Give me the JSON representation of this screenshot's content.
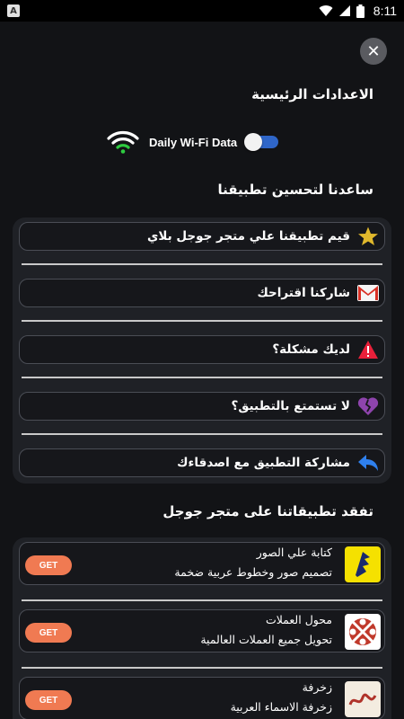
{
  "status_bar": {
    "app_badge": "A",
    "time": "8:11",
    "icons": [
      "wifi-icon",
      "signal-icon",
      "battery-icon"
    ]
  },
  "close_button": {
    "label": "✕"
  },
  "main_settings": {
    "title": "الاعدادات الرئيسية"
  },
  "wifi_setting": {
    "label": "Daily Wi-Fi Data",
    "enabled": false
  },
  "help_section": {
    "title": "ساعدنا لتحسين تطبيقنا",
    "items": [
      {
        "label": "قيم تطبيقنا علي متجر جوجل بلاي",
        "icon": "star-icon"
      },
      {
        "label": "شاركنا اقتراحك",
        "icon": "gmail-icon"
      },
      {
        "label": "لديك مشكلة؟",
        "icon": "warning-icon"
      },
      {
        "label": "لا تستمتع بالتطبيق؟",
        "icon": "broken-heart-icon"
      },
      {
        "label": "مشاركة التطبيق مع اصدقاءك",
        "icon": "share-arrow-icon"
      }
    ]
  },
  "apps_section": {
    "title": "تفقد تطبيقاتنا على متجر جوجل",
    "get_label": "GET",
    "apps": [
      {
        "name": "كتابة علي الصور",
        "desc": "تصميم صور وخطوط عربية ضخمة",
        "icon": "text-on-photos-app-icon"
      },
      {
        "name": "محول العملات",
        "desc": "تحويل جميع العملات العالمية",
        "icon": "currency-converter-app-icon"
      },
      {
        "name": "زخرفة",
        "desc": "زخرفة الاسماء العربية",
        "icon": "zakhrafa-app-icon"
      }
    ]
  },
  "colors": {
    "background": "#121316",
    "card": "#1f2126",
    "toggle_track": "#2f66c8",
    "get_button": "#f07a52"
  }
}
